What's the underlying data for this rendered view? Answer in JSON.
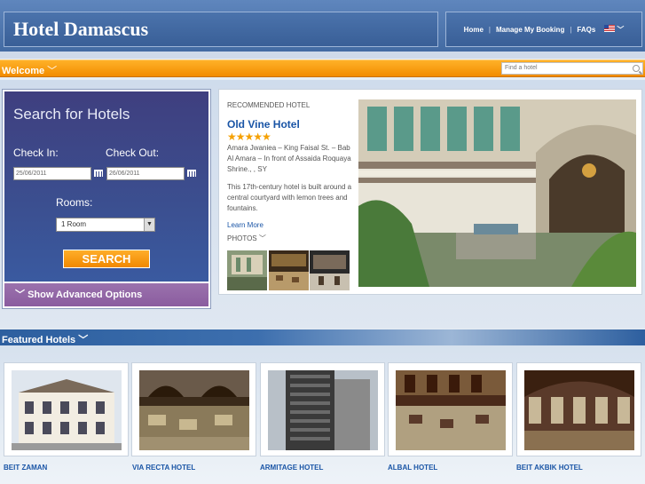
{
  "header": {
    "logo": "Hotel Damascus",
    "nav": {
      "home": "Home",
      "manage": "Manage My Booking",
      "faqs": "FAQs",
      "sep": "|"
    }
  },
  "welcome": {
    "label": "Welcome",
    "search_placeholder": "Find a hotel"
  },
  "search_panel": {
    "title": "Search for Hotels",
    "checkin_label": "Check In:",
    "checkout_label": "Check Out:",
    "checkin_value": "25/06/2011",
    "checkout_value": "26/06/2011",
    "rooms_label": "Rooms:",
    "rooms_value": "1 Room",
    "search_button": "SEARCH",
    "advanced": "Show Advanced Options"
  },
  "recommended": {
    "heading": "RECOMMENDED HOTEL",
    "name": "Old Vine Hotel",
    "stars": "★★★★★",
    "address": "Amara Jwaniea – King Faisal St. – Bab Al Amara – In front of Assaida Roquaya Shrine., , SY",
    "description": "This 17th-century hotel is built around a central courtyard with lemon trees and fountains.",
    "learn_more": "Learn More",
    "photos": "PHOTOS"
  },
  "featured": {
    "label": "Featured Hotels",
    "hotels": [
      "BEIT ZAMAN",
      "VIA RECTA HOTEL",
      "ARMITAGE HOTEL",
      "ALBAL HOTEL",
      "BEIT AKBIK HOTEL"
    ]
  },
  "colors": {
    "header_blue": "#4b73ac",
    "orange": "#f28c00",
    "link_blue": "#1a55a6",
    "purple": "#8a5c9f"
  }
}
